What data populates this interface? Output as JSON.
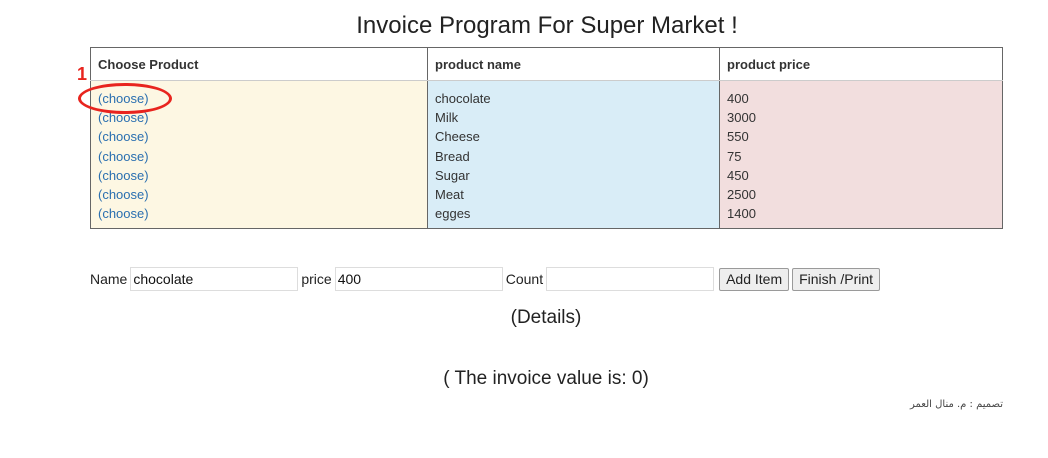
{
  "page": {
    "title": "Invoice Program For Super Market !"
  },
  "table": {
    "headers": [
      "Choose Product",
      "product name",
      "product price"
    ],
    "rows": [
      {
        "choose": "(choose)",
        "name": "chocolate",
        "price": "400"
      },
      {
        "choose": "(choose)",
        "name": "Milk",
        "price": "3000"
      },
      {
        "choose": "(choose)",
        "name": "Cheese",
        "price": "550"
      },
      {
        "choose": "(choose)",
        "name": "Bread",
        "price": "75"
      },
      {
        "choose": "(choose)",
        "name": "Sugar",
        "price": "450"
      },
      {
        "choose": "(choose)",
        "name": "Meat",
        "price": "2500"
      },
      {
        "choose": "(choose)",
        "name": "egges",
        "price": "1400"
      }
    ]
  },
  "annotation": {
    "number": "1",
    "color": "#e8241e"
  },
  "form": {
    "name_label": "Name",
    "name_value": "chocolate",
    "price_label": "price",
    "price_value": "400",
    "count_label": "Count",
    "count_value": "",
    "add_button": "Add Item",
    "finish_button": "Finish /Print"
  },
  "details": "(Details)",
  "invoice": {
    "text": "( The invoice value is: 0)"
  },
  "credit": "تصميم : م. منال العمر"
}
